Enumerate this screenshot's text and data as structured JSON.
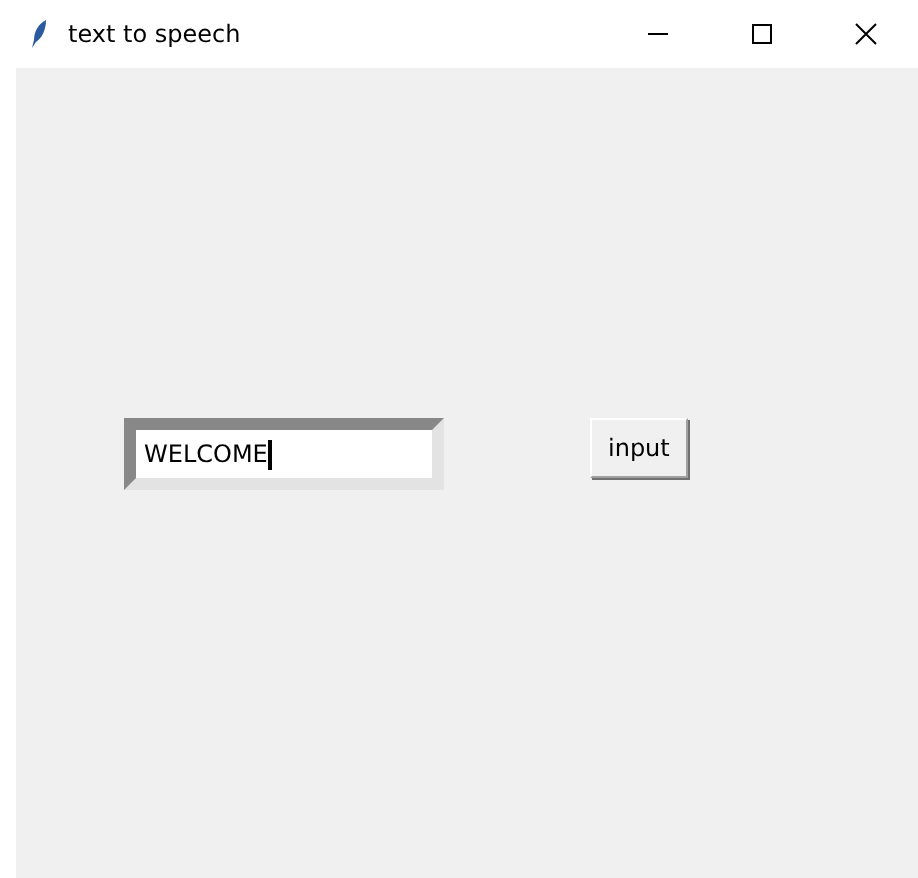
{
  "window": {
    "title": "text to speech"
  },
  "entry": {
    "value": "WELCOME"
  },
  "button": {
    "label": "input"
  }
}
